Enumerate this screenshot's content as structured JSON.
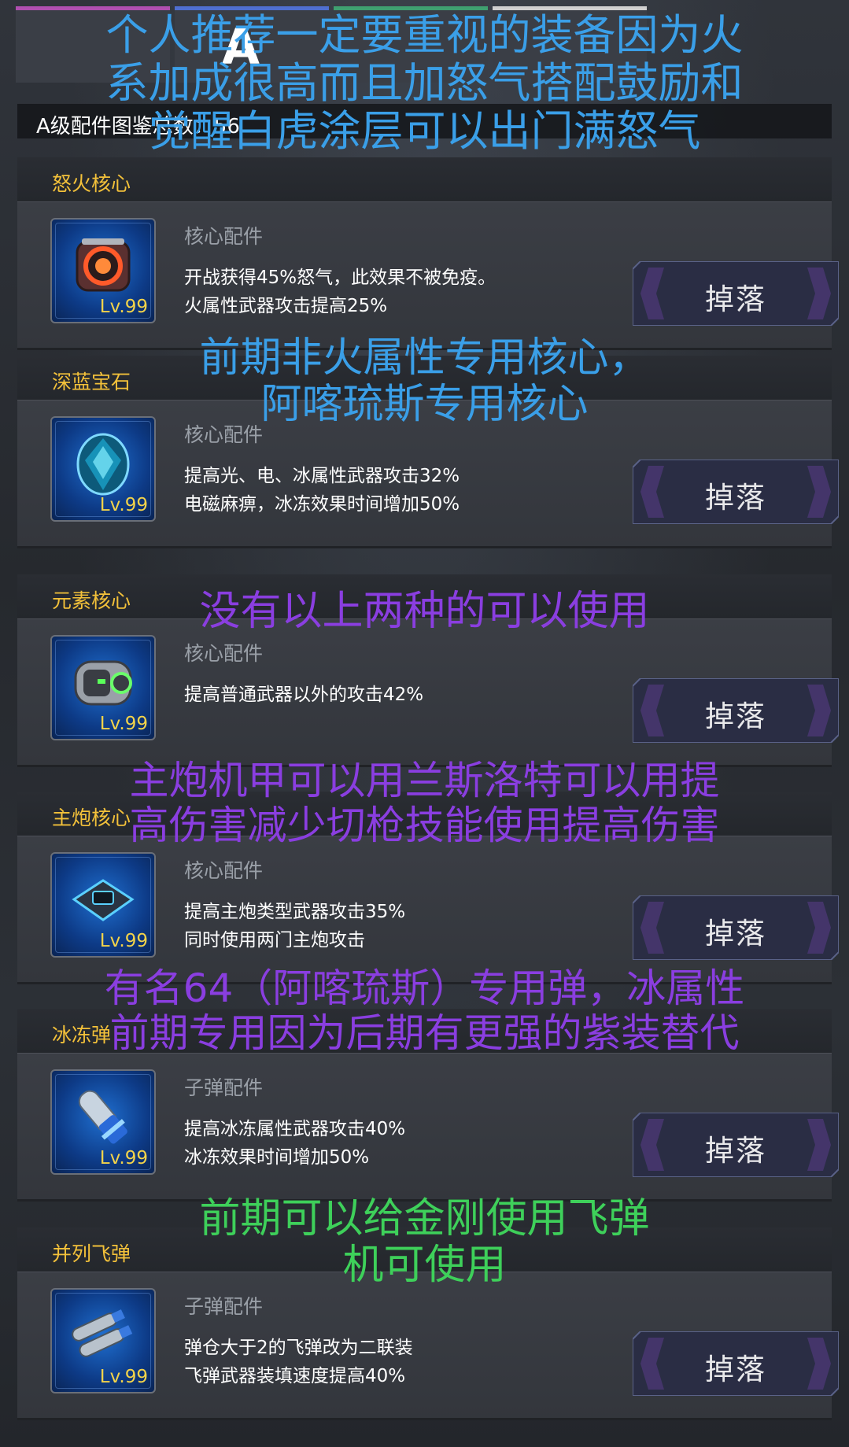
{
  "header": {
    "tab_letter": "A",
    "tab_colors": [
      "#b04fb0",
      "#4f6fd0",
      "#3fa070",
      "#d0d0d0"
    ],
    "count_text": "A级配件图鉴总数：56"
  },
  "items": [
    {
      "name": "怒火核心",
      "type": "核心配件",
      "desc": [
        "开战获得45%怒气，此效果不被免疫。",
        "火属性武器攻击提高25%"
      ],
      "level": "Lv.99",
      "button": "掉落",
      "icon": "red-core-icon"
    },
    {
      "name": "深蓝宝石",
      "type": "核心配件",
      "desc": [
        "提高光、电、冰属性武器攻击32%",
        "电磁麻痹，冰冻效果时间增加50%"
      ],
      "level": "Lv.99",
      "button": "掉落",
      "icon": "blue-gem-icon"
    },
    {
      "name": "元素核心",
      "type": "核心配件",
      "desc": [
        "提高普通武器以外的攻击42%"
      ],
      "level": "Lv.99",
      "button": "掉落",
      "icon": "element-core-icon"
    },
    {
      "name": "主炮核心",
      "type": "核心配件",
      "desc": [
        "提高主炮类型武器攻击35%",
        "同时使用两门主炮攻击"
      ],
      "level": "Lv.99",
      "button": "掉落",
      "icon": "cannon-core-icon"
    },
    {
      "name": "冰冻弹",
      "type": "子弹配件",
      "desc": [
        "提高冰冻属性武器攻击40%",
        "冰冻效果时间增加50%"
      ],
      "level": "Lv.99",
      "button": "掉落",
      "icon": "ice-bullet-icon"
    },
    {
      "name": "并列飞弹",
      "type": "子弹配件",
      "desc": [
        "弹仓大于2的飞弹改为二联装",
        "飞弹武器装填速度提高40%"
      ],
      "level": "Lv.99",
      "button": "掉落",
      "icon": "twin-missile-icon"
    }
  ],
  "annotations": [
    {
      "color": "#3a9fe8",
      "lines": [
        "个人推荐一定要重视的装备因为火",
        "系加成很高而且加怒气搭配鼓励和",
        "觉醒白虎涂层可以出门满怒气"
      ]
    },
    {
      "color": "#3a9fe8",
      "lines": [
        "前期非火属性专用核心，",
        "阿喀琉斯专用核心"
      ]
    },
    {
      "color": "#8a3ee0",
      "lines": [
        "没有以上两种的可以使用"
      ]
    },
    {
      "color": "#8a3ee0",
      "lines": [
        "主炮机甲可以用兰斯洛特可以用提",
        "高伤害减少切枪技能使用提高伤害"
      ]
    },
    {
      "color": "#8a3ee0",
      "lines": [
        "有名64（阿喀琉斯）专用弹，冰属性",
        "前期专用因为后期有更强的紫装替代"
      ]
    },
    {
      "color": "#3ed05a",
      "lines": [
        "前期可以给金刚使用飞弹",
        "机可使用"
      ]
    }
  ]
}
